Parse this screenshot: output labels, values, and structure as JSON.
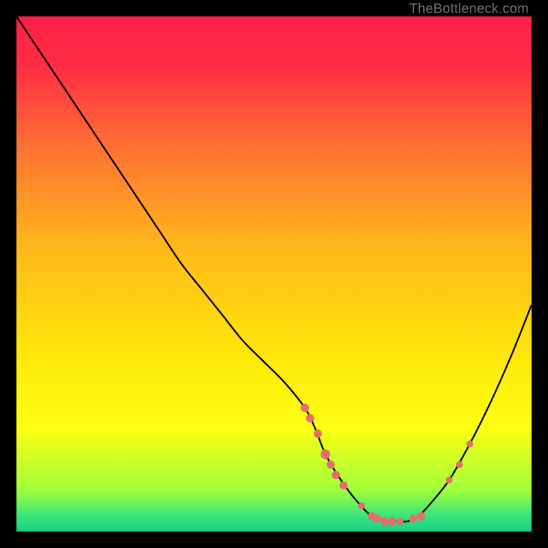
{
  "watermark": "TheBottleneck.com",
  "chart_data": {
    "type": "line",
    "title": "",
    "xlabel": "",
    "ylabel": "",
    "xlim": [
      0,
      100
    ],
    "ylim": [
      0,
      100
    ],
    "background_gradient": {
      "stops": [
        {
          "offset": 0.0,
          "color": "#ff1f49"
        },
        {
          "offset": 0.1,
          "color": "#ff2e44"
        },
        {
          "offset": 0.25,
          "color": "#ff6f33"
        },
        {
          "offset": 0.45,
          "color": "#ffb81b"
        },
        {
          "offset": 0.65,
          "color": "#ffe60a"
        },
        {
          "offset": 0.8,
          "color": "#fdff12"
        },
        {
          "offset": 0.92,
          "color": "#9fff3a"
        },
        {
          "offset": 0.97,
          "color": "#38e47b"
        },
        {
          "offset": 1.0,
          "color": "#18cf86"
        }
      ]
    },
    "series": [
      {
        "name": "bottleneck-curve",
        "color": "#000000",
        "x": [
          0,
          4,
          8,
          12,
          16,
          20,
          24,
          28,
          32,
          36,
          40,
          44,
          48,
          52,
          56,
          58,
          60,
          63,
          66,
          69,
          72,
          74,
          76,
          78,
          80,
          84,
          88,
          92,
          96,
          100
        ],
        "y": [
          100,
          94,
          88,
          82,
          76,
          70,
          64,
          58,
          52,
          47,
          42,
          37,
          33,
          29,
          24,
          20,
          15,
          10,
          6,
          3,
          2,
          2,
          2,
          3,
          5,
          10,
          17,
          25,
          34,
          44
        ]
      }
    ],
    "markers": {
      "color": "#e46e6e",
      "points": [
        {
          "x": 56,
          "y": 24,
          "r": 6
        },
        {
          "x": 57,
          "y": 22,
          "r": 6
        },
        {
          "x": 58.5,
          "y": 19,
          "r": 6
        },
        {
          "x": 60,
          "y": 15,
          "r": 7
        },
        {
          "x": 61,
          "y": 13,
          "r": 6
        },
        {
          "x": 62,
          "y": 11,
          "r": 6
        },
        {
          "x": 63.5,
          "y": 9,
          "r": 6
        },
        {
          "x": 67,
          "y": 5,
          "r": 5
        },
        {
          "x": 69,
          "y": 3,
          "r": 6
        },
        {
          "x": 70,
          "y": 2.5,
          "r": 6
        },
        {
          "x": 71.5,
          "y": 2,
          "r": 6
        },
        {
          "x": 73,
          "y": 2,
          "r": 6
        },
        {
          "x": 74.5,
          "y": 2,
          "r": 5
        },
        {
          "x": 77,
          "y": 2.5,
          "r": 6
        },
        {
          "x": 78.5,
          "y": 3,
          "r": 6
        },
        {
          "x": 84,
          "y": 10,
          "r": 5
        },
        {
          "x": 86,
          "y": 13,
          "r": 5
        },
        {
          "x": 88,
          "y": 17,
          "r": 5
        }
      ]
    }
  }
}
